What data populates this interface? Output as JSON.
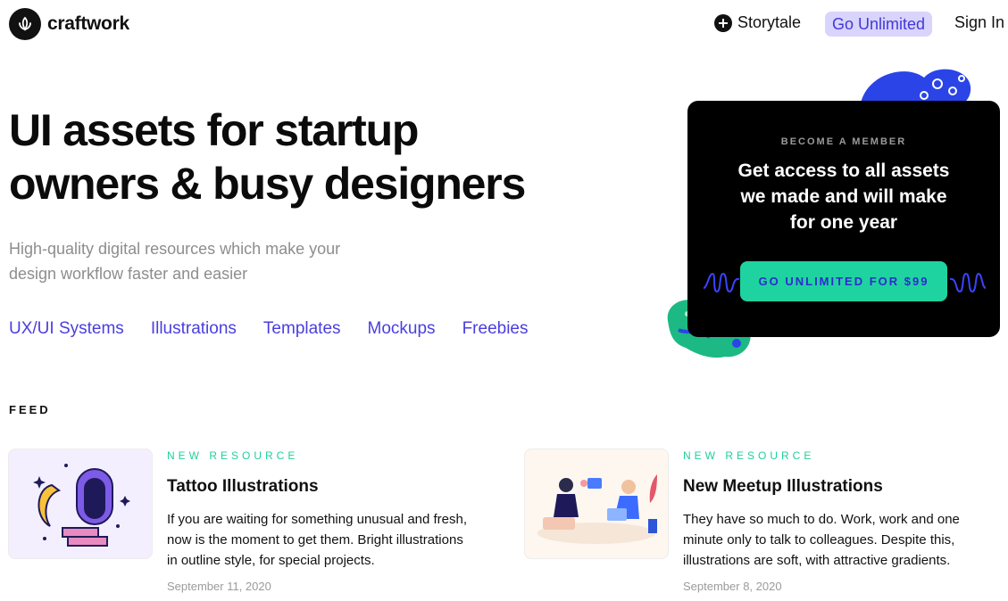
{
  "header": {
    "brand": "craftwork",
    "storytale_label": "Storytale",
    "unlimited_label": "Go Unlimited",
    "signin_label": "Sign In"
  },
  "hero": {
    "title_line1": "UI assets for startup",
    "title_line2": "owners & busy designers",
    "subtitle_line1": "High-quality digital resources which make your",
    "subtitle_line2": "design workflow faster and easier",
    "categories": [
      "UX/UI Systems",
      "Illustrations",
      "Templates",
      "Mockups",
      "Freebies"
    ]
  },
  "member_card": {
    "label": "BECOME A MEMBER",
    "title_line1": "Get access to all assets",
    "title_line2": "we made and will make",
    "title_line3": "for one year",
    "button_label": "GO UNLIMITED FOR $99"
  },
  "feed": {
    "heading": "FEED",
    "items": [
      {
        "badge": "NEW RESOURCE",
        "title": "Tattoo Illustrations",
        "desc_line1": "If you are waiting for something unusual and fresh,",
        "desc_line2": "now is the moment to get them. Bright illustrations",
        "desc_line3": "in outline style, for special projects.",
        "date": "September 11, 2020"
      },
      {
        "badge": "NEW RESOURCE",
        "title": "New Meetup Illustrations",
        "desc_line1": "They have so much to do. Work, work and one",
        "desc_line2": "minute only to talk to colleagues. Despite this,",
        "desc_line3": "illustrations are soft, with attractive gradients.",
        "date": "September 8, 2020"
      }
    ]
  },
  "colors": {
    "accent_purple": "#4a3ee0",
    "accent_green": "#1fd3a0",
    "pill_bg": "#d8d4fb"
  }
}
